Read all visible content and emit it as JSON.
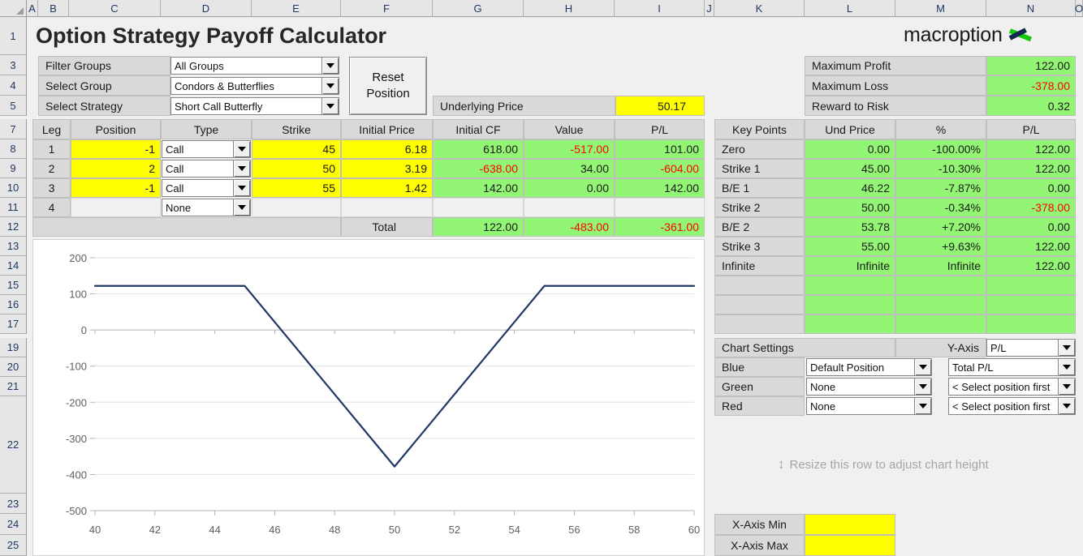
{
  "app": {
    "title": "Option Strategy Payoff Calculator",
    "logo_word": "macroption"
  },
  "grid": {
    "columns": [
      "A",
      "B",
      "C",
      "D",
      "E",
      "F",
      "G",
      "H",
      "I",
      "J",
      "K",
      "L",
      "M",
      "N",
      "O"
    ],
    "rows": [
      "1",
      "3",
      "4",
      "5",
      "7",
      "8",
      "9",
      "10",
      "11",
      "12",
      "13",
      "14",
      "15",
      "16",
      "17",
      "19",
      "20",
      "21",
      "22",
      "23",
      "24",
      "25"
    ]
  },
  "selectors": {
    "filter_groups_label": "Filter Groups",
    "filter_groups_value": "All Groups",
    "select_group_label": "Select Group",
    "select_group_value": "Condors & Butterflies",
    "select_strategy_label": "Select Strategy",
    "select_strategy_value": "Short Call Butterfly",
    "reset_line1": "Reset",
    "reset_line2": "Position"
  },
  "underlying": {
    "label": "Underlying Price",
    "value": "50.17"
  },
  "legs": {
    "headers": [
      "Leg",
      "Position",
      "Type",
      "Strike",
      "Initial Price",
      "Initial CF",
      "Value",
      "P/L"
    ],
    "rows": [
      {
        "leg": "1",
        "position": "-1",
        "type": "Call",
        "strike": "45",
        "initial_price": "6.18",
        "initial_cf": "618.00",
        "value": "-517.00",
        "pl": "101.00",
        "cf_neg": false,
        "value_neg": true,
        "pl_neg": false
      },
      {
        "leg": "2",
        "position": "2",
        "type": "Call",
        "strike": "50",
        "initial_price": "3.19",
        "initial_cf": "-638.00",
        "value": "34.00",
        "pl": "-604.00",
        "cf_neg": true,
        "value_neg": false,
        "pl_neg": true
      },
      {
        "leg": "3",
        "position": "-1",
        "type": "Call",
        "strike": "55",
        "initial_price": "1.42",
        "initial_cf": "142.00",
        "value": "0.00",
        "pl": "142.00",
        "cf_neg": false,
        "value_neg": false,
        "pl_neg": false
      },
      {
        "leg": "4",
        "position": "",
        "type": "None",
        "strike": "",
        "initial_price": "",
        "initial_cf": "",
        "value": "",
        "pl": "",
        "cf_neg": false,
        "value_neg": false,
        "pl_neg": false
      }
    ],
    "total_label": "Total",
    "total_initial_cf": "122.00",
    "total_value": "-483.00",
    "total_pl": "-361.00"
  },
  "summary": {
    "max_profit_label": "Maximum Profit",
    "max_profit_value": "122.00",
    "max_loss_label": "Maximum Loss",
    "max_loss_value": "-378.00",
    "reward_risk_label": "Reward to Risk",
    "reward_risk_value": "0.32"
  },
  "key_points": {
    "headers": [
      "Key Points",
      "Und Price",
      "%",
      "P/L"
    ],
    "rows": [
      {
        "name": "Zero",
        "und": "0.00",
        "pct": "-100.00%",
        "pl": "122.00",
        "pl_neg": false
      },
      {
        "name": "Strike 1",
        "und": "45.00",
        "pct": "-10.30%",
        "pl": "122.00",
        "pl_neg": false
      },
      {
        "name": "B/E 1",
        "und": "46.22",
        "pct": "-7.87%",
        "pl": "0.00",
        "pl_neg": false
      },
      {
        "name": "Strike 2",
        "und": "50.00",
        "pct": "-0.34%",
        "pl": "-378.00",
        "pl_neg": true
      },
      {
        "name": "B/E 2",
        "und": "53.78",
        "pct": "+7.20%",
        "pl": "0.00",
        "pl_neg": false
      },
      {
        "name": "Strike 3",
        "und": "55.00",
        "pct": "+9.63%",
        "pl": "122.00",
        "pl_neg": false
      },
      {
        "name": "Infinite",
        "und": "Infinite",
        "pct": "Infinite",
        "pl": "122.00",
        "pl_neg": false
      },
      {
        "name": "",
        "und": "",
        "pct": "",
        "pl": "",
        "pl_neg": false
      },
      {
        "name": "",
        "und": "",
        "pct": "",
        "pl": "",
        "pl_neg": false
      },
      {
        "name": "",
        "und": "",
        "pct": "",
        "pl": "",
        "pl_neg": false
      }
    ]
  },
  "chart_settings": {
    "title": "Chart Settings",
    "y_axis_label": "Y-Axis",
    "y_axis_value": "P/L",
    "rows": [
      {
        "color_label": "Blue",
        "position": "Default Position",
        "series": "Total P/L"
      },
      {
        "color_label": "Green",
        "position": "None",
        "series": "< Select position first"
      },
      {
        "color_label": "Red",
        "position": "None",
        "series": "< Select position first"
      }
    ]
  },
  "resize_hint": "Resize this row to adjust chart height",
  "axis_inputs": {
    "x_min_label": "X-Axis Min",
    "x_min_value": "",
    "x_max_label": "X-Axis Max",
    "x_max_value": ""
  },
  "chart_data": {
    "type": "line",
    "title": "",
    "xlabel": "",
    "ylabel": "",
    "xlim": [
      40,
      60
    ],
    "ylim": [
      -500,
      200
    ],
    "xticks": [
      40,
      42,
      44,
      46,
      48,
      50,
      52,
      54,
      56,
      58,
      60
    ],
    "yticks": [
      -500,
      -400,
      -300,
      -200,
      -100,
      0,
      100,
      200
    ],
    "grid": true,
    "legend": "none",
    "series": [
      {
        "name": "Total P/L",
        "color": "#1f3864",
        "x": [
          40,
          45,
          46.22,
          50,
          53.78,
          55,
          60
        ],
        "y": [
          122,
          122,
          0,
          -378,
          0,
          122,
          122
        ]
      }
    ]
  }
}
